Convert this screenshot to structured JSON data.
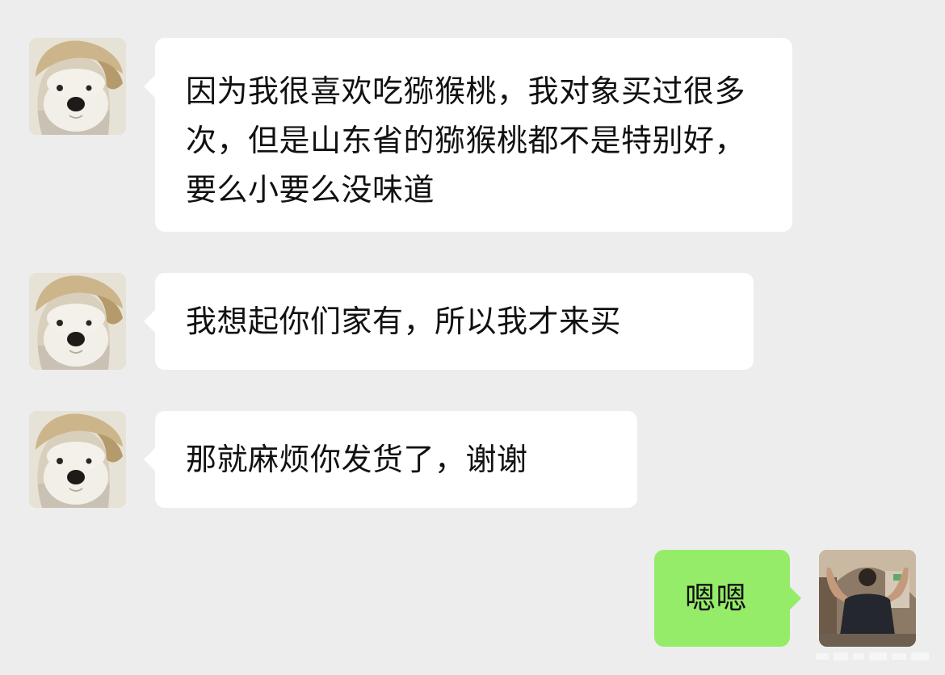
{
  "conversation": {
    "messages": [
      {
        "sender": "contact",
        "avatar_icon": "dog-plush-hat-avatar-icon",
        "text": "因为我很喜欢吃猕猴桃，我对象买过很多次，但是山东省的猕猴桃都不是特别好，要么小要么没味道"
      },
      {
        "sender": "contact",
        "avatar_icon": "dog-plush-hat-avatar-icon",
        "text": "我想起你们家有，所以我才来买"
      },
      {
        "sender": "contact",
        "avatar_icon": "dog-plush-hat-avatar-icon",
        "text": "那就麻烦你发货了，谢谢"
      },
      {
        "sender": "self",
        "avatar_icon": "man-flexing-photo-avatar-icon",
        "text": "嗯嗯"
      }
    ]
  },
  "colors": {
    "background": "#ededed",
    "incoming_bubble": "#ffffff",
    "outgoing_bubble": "#95ec69",
    "text": "#111111"
  }
}
